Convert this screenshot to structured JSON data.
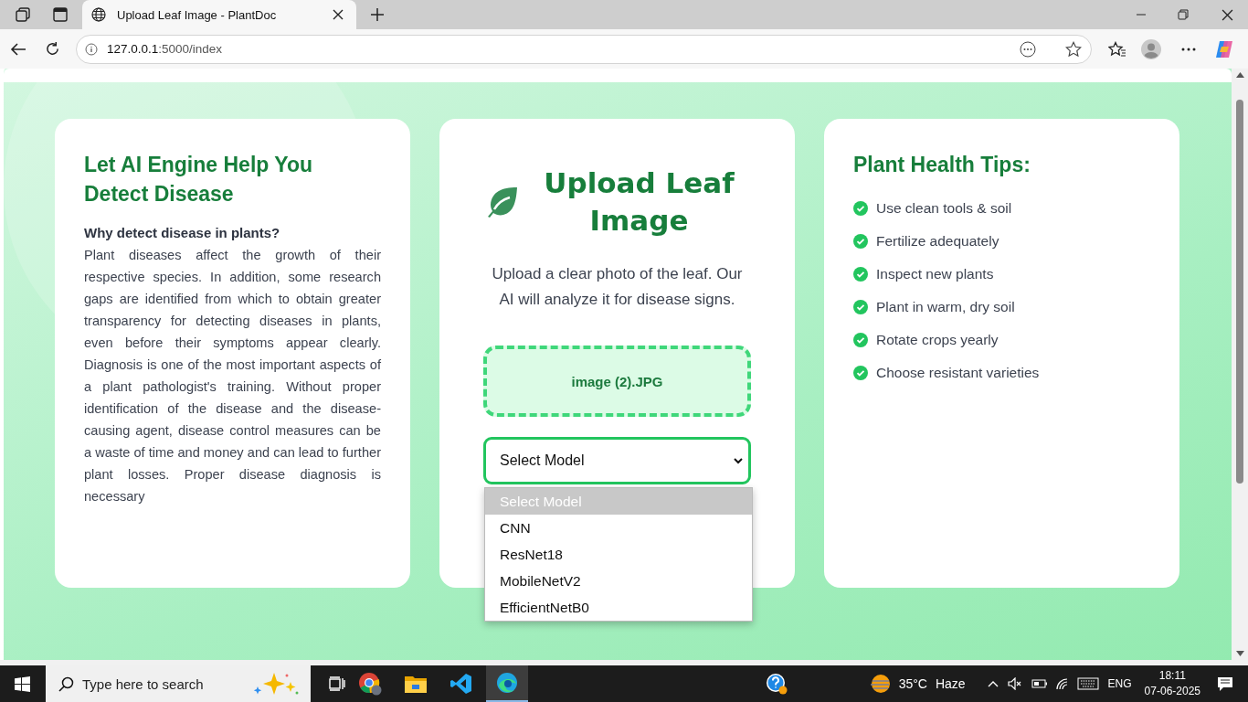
{
  "browser": {
    "tabs": [
      {
        "title": "Upload Leaf Image - PlantDoc",
        "selected": true
      }
    ],
    "address": {
      "host": "127.0.0.1",
      "path": ":5000/index"
    }
  },
  "info_card": {
    "title": "Let AI Engine Help You Detect Disease",
    "subtitle": "Why detect disease in plants?",
    "body": "Plant diseases affect the growth of their respective species. In addition, some research gaps are identified from which to obtain greater transparency for detecting diseases in plants, even before their symptoms appear clearly. Diagnosis is one of the most important aspects of a plant pathologist's training. Without proper identification of the disease and the disease-causing agent, disease control measures can be a waste of time and money and can lead to further plant losses. Proper disease diagnosis is necessary"
  },
  "upload_card": {
    "title": "Upload Leaf Image",
    "description": "Upload a clear photo of the leaf. Our AI will analyze it for disease signs.",
    "file_name": "image (2).JPG",
    "model_select": {
      "value": "Select Model",
      "expanded": true,
      "options": [
        {
          "label": "Select Model",
          "selected": true
        },
        {
          "label": "CNN",
          "selected": false
        },
        {
          "label": "ResNet18",
          "selected": false
        },
        {
          "label": "MobileNetV2",
          "selected": false
        },
        {
          "label": "EfficientNetB0",
          "selected": false
        }
      ]
    }
  },
  "tips_card": {
    "title": "Plant Health Tips:",
    "tips": [
      "Use clean tools & soil",
      "Fertilize adequately",
      "Inspect new plants",
      "Plant in warm, dry soil",
      "Rotate crops yearly",
      "Choose resistant varieties"
    ]
  },
  "taskbar": {
    "search": {
      "placeholder": "Type here to search"
    },
    "temperature": "35°C",
    "weather": "Haze",
    "language": "ENG",
    "time": "18:11",
    "date": "07-06-2025"
  }
}
